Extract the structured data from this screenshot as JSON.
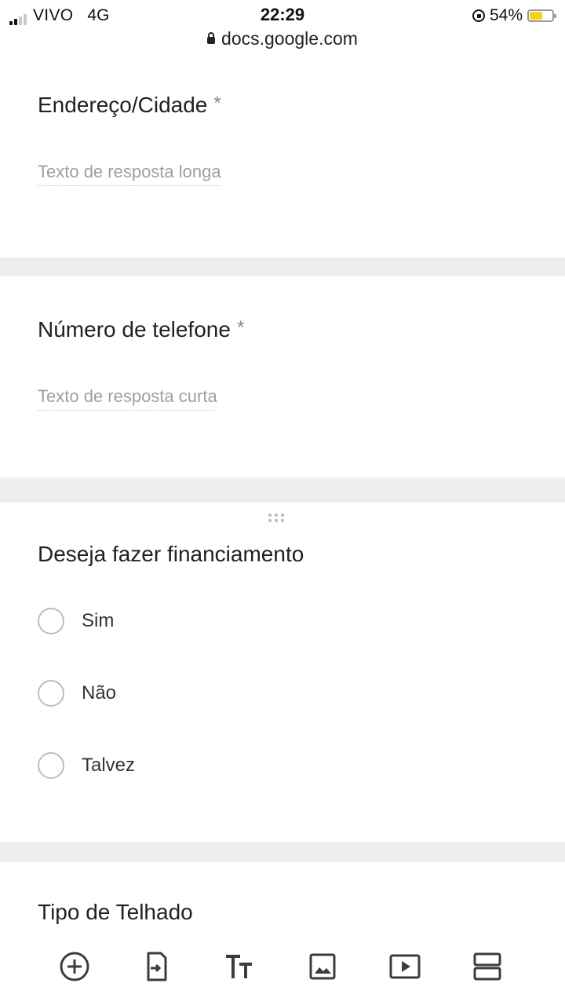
{
  "status": {
    "carrier": "VIVO",
    "network": "4G",
    "time": "22:29",
    "battery_percent_label": "54%",
    "battery_level": 0.54,
    "battery_color": "#f3d31a"
  },
  "browser": {
    "url": "docs.google.com"
  },
  "form": {
    "q_address": {
      "title": "Endereço/Cidade",
      "required": "*",
      "placeholder": "Texto de resposta longa"
    },
    "q_phone": {
      "title": "Número de telefone",
      "required": "*",
      "placeholder": "Texto de resposta curta"
    },
    "q_financing": {
      "title": "Deseja fazer financiamento",
      "options": [
        "Sim",
        "Não",
        "Talvez"
      ]
    },
    "q_roof": {
      "title": "Tipo de Telhado"
    }
  },
  "toolbar": {
    "icons": [
      "add-question-icon",
      "import-questions-icon",
      "add-title-icon",
      "add-image-icon",
      "add-video-icon",
      "add-section-icon"
    ]
  }
}
